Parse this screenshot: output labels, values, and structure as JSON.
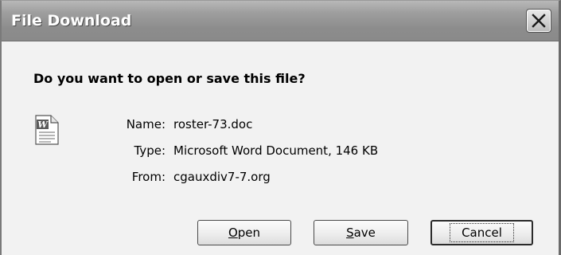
{
  "window": {
    "title": "File Download",
    "close_icon": "close-x-icon"
  },
  "dialog": {
    "question": "Do you want to open or save this file?",
    "file_icon": "word-document-icon",
    "name_label": "Name:",
    "name_value": "roster-73.doc",
    "type_label": "Type:",
    "type_value": "Microsoft Word Document, 146 KB",
    "from_label": "From:",
    "from_value": "cgauxdiv7-7.org"
  },
  "buttons": {
    "open_mnemonic": "O",
    "open_rest": "pen",
    "save_mnemonic": "S",
    "save_rest": "ave",
    "cancel_label": "Cancel"
  }
}
